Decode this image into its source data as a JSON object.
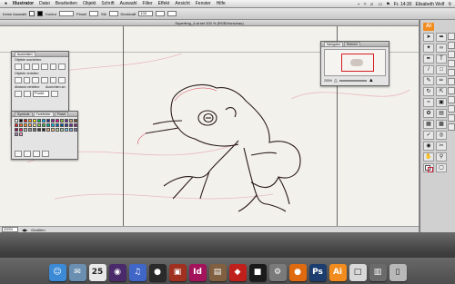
{
  "menubar": {
    "apple": "",
    "app": "Illustrator",
    "items": [
      "Datei",
      "Bearbeiten",
      "Objekt",
      "Schrift",
      "Auswahl",
      "Filter",
      "Effekt",
      "Ansicht",
      "Fenster",
      "Hilfe"
    ],
    "status": {
      "day_time": "Fr. 14:30",
      "user": "Elisabeth Wolf"
    }
  },
  "control": {
    "selection": "Keine Auswahl",
    "kontur_label": "Kontur",
    "pinsel_label": "Pinsel",
    "stil_label": "Stil",
    "deckkraft_label": "Deckkraft",
    "deckkraft_value": "100"
  },
  "document": {
    "title": "Superfrog_4.ai bei 200 % (RGB/Vorschau)"
  },
  "panels": {
    "ausrichten": {
      "tab": "Ausrichten",
      "row1": "Objekte ausrichten:",
      "row2": "Objekte verteilen:",
      "row3": "Abstand verteilen:",
      "row3b": "Ausrichten an:",
      "mode": "Punkt"
    },
    "swatches": {
      "tabs": [
        "Symbole",
        "Farbfelder",
        "Pinsel"
      ]
    },
    "navigator": {
      "tabs": [
        "Navigator",
        "Ebenen"
      ],
      "zoom": "200%"
    }
  },
  "status": {
    "zoom": "200%",
    "mode": "Gezillfen"
  },
  "colors": {
    "app_accent": "#f28c1e",
    "stroke_red": "#c81c35",
    "swatch_palette": [
      "#ffffff",
      "#000000",
      "#e31b23",
      "#f7941d",
      "#fff200",
      "#00a651",
      "#00aeef",
      "#2e3192",
      "#92278f",
      "#ec008c",
      "#8dc63f",
      "#662d91",
      "#c69c6d",
      "#754c24",
      "#ed1c24",
      "#f26522",
      "#f7941d",
      "#fbaf5d",
      "#fff799",
      "#8dc63f",
      "#39b54a",
      "#00a99d",
      "#00bff3",
      "#0072bc",
      "#0054a6",
      "#2e3192",
      "#662d91",
      "#92278f",
      "#9e005d",
      "#ed145b",
      "#bcbec0",
      "#939598",
      "#6d6e71",
      "#414042",
      "#231f20",
      "#f9ad81",
      "#fdc689",
      "#c4df9b",
      "#a3d39c",
      "#6dcff6",
      "#7da7d9",
      "#8781bd",
      "#a186be",
      "#f49ac2"
    ]
  },
  "dock": {
    "apps": [
      {
        "icon": "finder-icon",
        "glyph": "☺",
        "color": "#3c8ad6"
      },
      {
        "icon": "mail-icon",
        "glyph": "✉",
        "color": "#6b8fb0"
      },
      {
        "icon": "calendar-icon",
        "glyph": "25",
        "color": "#e8e8e8"
      },
      {
        "icon": "photo-booth-icon",
        "glyph": "◉",
        "color": "#4a2a6a"
      },
      {
        "icon": "itunes-icon",
        "glyph": "♫",
        "color": "#4066c8"
      },
      {
        "icon": "dvd-icon",
        "glyph": "●",
        "color": "#2a2a2a"
      },
      {
        "icon": "photos-icon",
        "glyph": "▣",
        "color": "#a03020"
      },
      {
        "icon": "indesign-icon",
        "glyph": "Id",
        "color": "#a3135b"
      },
      {
        "icon": "preview-icon",
        "glyph": "▤",
        "color": "#806040"
      },
      {
        "icon": "acrobat-icon",
        "glyph": "◆",
        "color": "#c0201c"
      },
      {
        "icon": "terminal-icon",
        "glyph": "■",
        "color": "#1a1a1a"
      },
      {
        "icon": "system-preferences-icon",
        "glyph": "⚙",
        "color": "#7a7a7a"
      },
      {
        "icon": "firefox-icon",
        "glyph": "●",
        "color": "#e06a10"
      },
      {
        "icon": "photoshop-icon",
        "glyph": "Ps",
        "color": "#1c3d6e"
      },
      {
        "icon": "illustrator-icon",
        "glyph": "Ai",
        "color": "#f28c1e"
      },
      {
        "icon": "document-icon",
        "glyph": "□",
        "color": "#d8d8d8"
      },
      {
        "icon": "downloads-icon",
        "glyph": "▥",
        "color": "#6a6a6a"
      },
      {
        "icon": "trash-icon",
        "glyph": "▯",
        "color": "#b8b8b8"
      }
    ]
  }
}
